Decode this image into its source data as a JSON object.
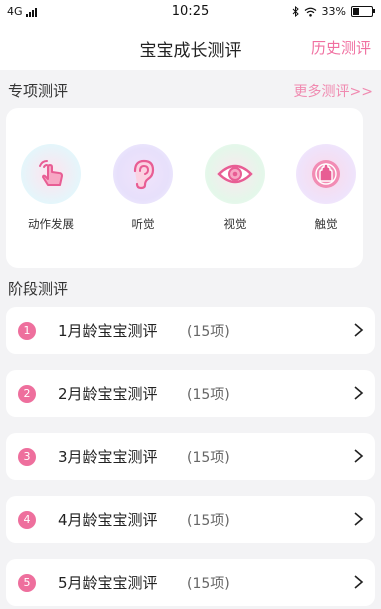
{
  "status_bar": {
    "network": "4G",
    "time": "10:25",
    "battery_percent": "33%",
    "battery_level": 0.33
  },
  "header": {
    "title": "宝宝成长测评",
    "history_link": "历史测评"
  },
  "special": {
    "title": "专项测评",
    "more_link": "更多测评>>",
    "items": [
      {
        "label": "动作发展",
        "icon": "hand-tap-icon"
      },
      {
        "label": "听觉",
        "icon": "ear-icon"
      },
      {
        "label": "视觉",
        "icon": "eye-icon"
      },
      {
        "label": "触觉",
        "icon": "touch-icon"
      }
    ]
  },
  "stages": {
    "title": "阶段测评",
    "items": [
      {
        "num": "1",
        "title": "1月龄宝宝测评",
        "count": "(15项)"
      },
      {
        "num": "2",
        "title": "2月龄宝宝测评",
        "count": "(15项)"
      },
      {
        "num": "3",
        "title": "3月龄宝宝测评",
        "count": "(15项)"
      },
      {
        "num": "4",
        "title": "4月龄宝宝测评",
        "count": "(15项)"
      },
      {
        "num": "5",
        "title": "5月龄宝宝测评",
        "count": "(15项)"
      }
    ]
  },
  "colors": {
    "accent": "#f06fa0",
    "badge": "#ee6f9d"
  }
}
